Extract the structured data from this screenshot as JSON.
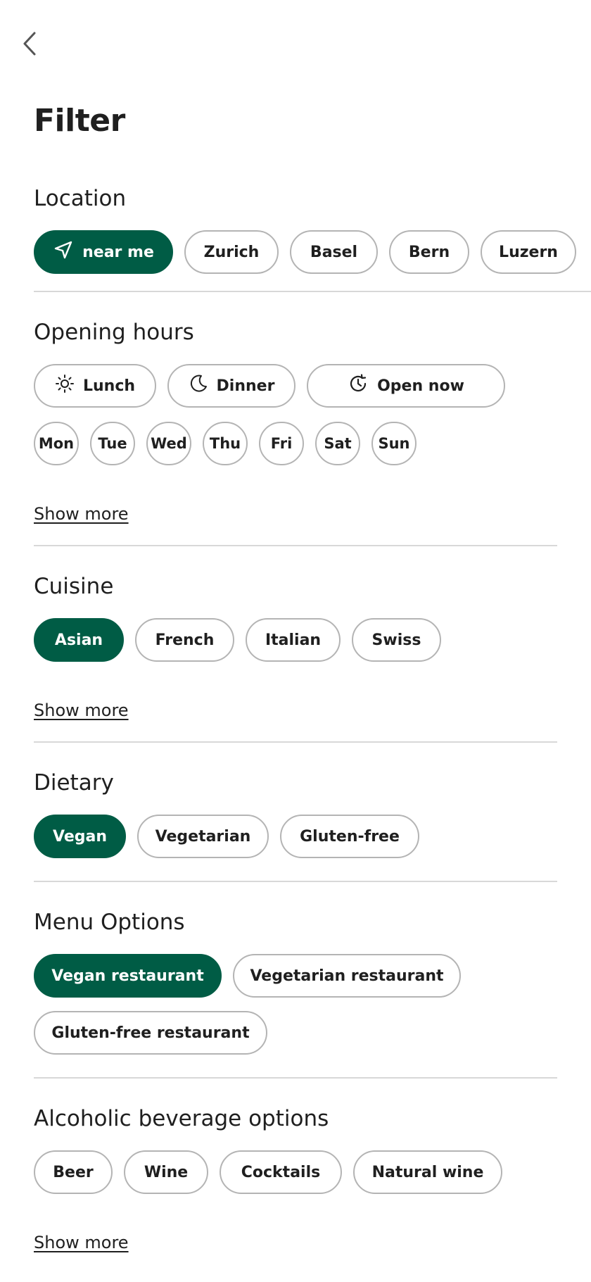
{
  "header": {
    "back_icon": "chevron-left-icon",
    "title": "Filter"
  },
  "location": {
    "title": "Location",
    "near_me": {
      "label": "near me",
      "icon": "navigation-arrow-icon",
      "active": true
    },
    "cities": [
      "Zurich",
      "Basel",
      "Bern",
      "Luzern"
    ]
  },
  "opening_hours": {
    "title": "Opening hours",
    "times": [
      {
        "label": "Lunch",
        "icon": "sun-icon"
      },
      {
        "label": "Dinner",
        "icon": "moon-icon"
      },
      {
        "label": "Open now",
        "icon": "clock-refresh-icon"
      }
    ],
    "days": [
      "Mon",
      "Tue",
      "Wed",
      "Thu",
      "Fri",
      "Sat",
      "Sun"
    ],
    "show_more": "Show more"
  },
  "cuisine": {
    "title": "Cuisine",
    "options": [
      "Asian",
      "French",
      "Italian",
      "Swiss"
    ],
    "active": "Asian",
    "show_more": "Show more"
  },
  "dietary": {
    "title": "Dietary",
    "options": [
      "Vegan",
      "Vegetarian",
      "Gluten-free"
    ],
    "active": "Vegan"
  },
  "menu_options": {
    "title": "Menu Options",
    "options": [
      "Vegan restaurant",
      "Vegetarian restaurant",
      "Gluten-free restaurant"
    ],
    "active": "Vegan restaurant"
  },
  "alcohol": {
    "title": "Alcoholic beverage options",
    "options": [
      "Beer",
      "Wine",
      "Cocktails",
      "Natural wine"
    ],
    "show_more": "Show more"
  },
  "colors": {
    "accent": "#005c45",
    "chip_border": "#b4b4b4",
    "divider": "#d8d8d8",
    "text": "#1f1f1f"
  }
}
